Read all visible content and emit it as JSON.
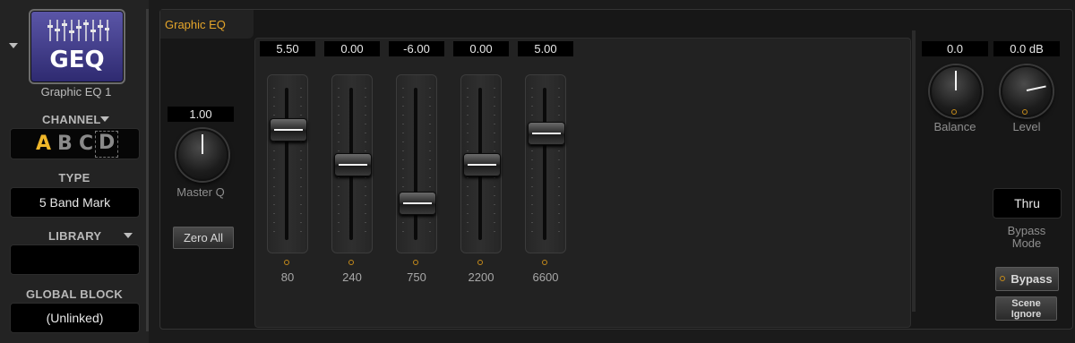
{
  "block": {
    "icon_text": "GEQ",
    "name": "Graphic EQ 1"
  },
  "channel": {
    "heading": "CHANNEL",
    "options": [
      "A",
      "B",
      "C",
      "D"
    ],
    "selected": "A"
  },
  "type": {
    "heading": "TYPE",
    "value": "5 Band Mark"
  },
  "library": {
    "heading": "LIBRARY",
    "value": ""
  },
  "global_block": {
    "heading": "GLOBAL BLOCK",
    "value": "(Unlinked)"
  },
  "panel_title": "Graphic EQ",
  "master_q": {
    "value": "1.00",
    "label": "Master Q"
  },
  "zero_all_label": "Zero All",
  "bands": [
    {
      "freq": "80",
      "gain": "5.50",
      "gain_num": 5.5
    },
    {
      "freq": "240",
      "gain": "0.00",
      "gain_num": 0
    },
    {
      "freq": "750",
      "gain": "-6.00",
      "gain_num": -6
    },
    {
      "freq": "2200",
      "gain": "0.00",
      "gain_num": 0
    },
    {
      "freq": "6600",
      "gain": "5.00",
      "gain_num": 5
    }
  ],
  "balance": {
    "value": "0.0",
    "label": "Balance"
  },
  "level": {
    "value": "0.0 dB",
    "label": "Level"
  },
  "bypass_mode": {
    "value": "Thru",
    "label_line1": "Bypass",
    "label_line2": "Mode"
  },
  "bypass_button": "Bypass",
  "scene_ignore": {
    "line1": "Scene",
    "line2": "Ignore"
  },
  "colors": {
    "accent": "#e5a52a",
    "led": "#c48a1a"
  }
}
